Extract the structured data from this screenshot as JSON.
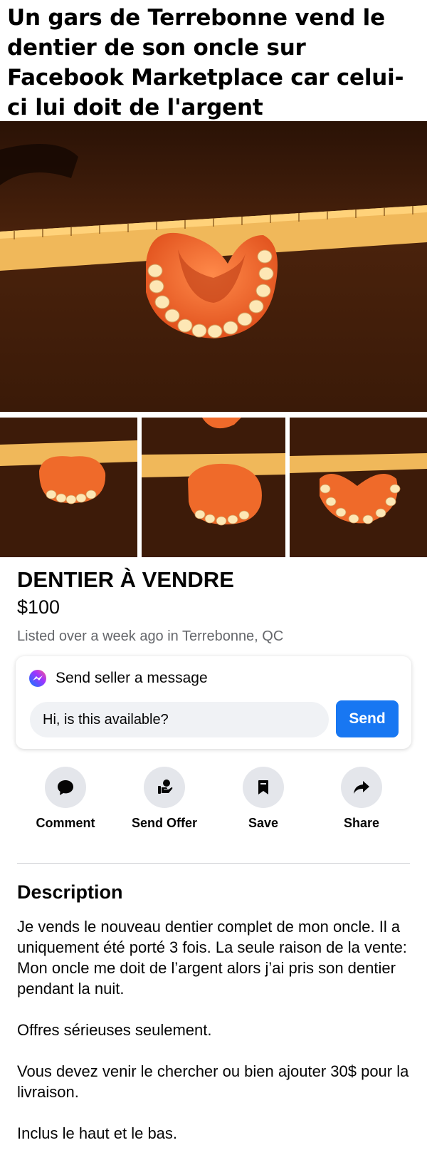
{
  "headline": "Un gars de Terrebonne vend le dentier de son oncle sur Facebook Marketplace car celui-ci lui doit de l'argent",
  "listing": {
    "title": "DENTIER À VENDRE",
    "price": "$100",
    "meta": "Listed over a week ago in Terrebonne, QC"
  },
  "message": {
    "heading": "Send seller a message",
    "input_value": "Hi, is this available?",
    "send_label": "Send"
  },
  "actions": [
    {
      "label": "Comment",
      "icon": "comment-icon"
    },
    {
      "label": "Send Offer",
      "icon": "offer-icon"
    },
    {
      "label": "Save",
      "icon": "bookmark-icon"
    },
    {
      "label": "Share",
      "icon": "share-icon"
    }
  ],
  "description": {
    "heading": "Description",
    "paragraphs": [
      "Je vends le nouveau dentier complet de mon oncle. Il a uniquement été porté 3 fois. La seule raison de la vente: Mon oncle me doit de l’argent alors j’ai pris son dentier pendant la nuit.",
      "Offres sérieuses seulement.",
      "Vous devez venir le chercher ou bien ajouter 30$ pour la livraison.",
      "Inclus le haut et le bas."
    ]
  },
  "colors": {
    "accent": "#1877f2",
    "secondary_text": "#65676b",
    "button_bg": "#e4e6eb"
  }
}
